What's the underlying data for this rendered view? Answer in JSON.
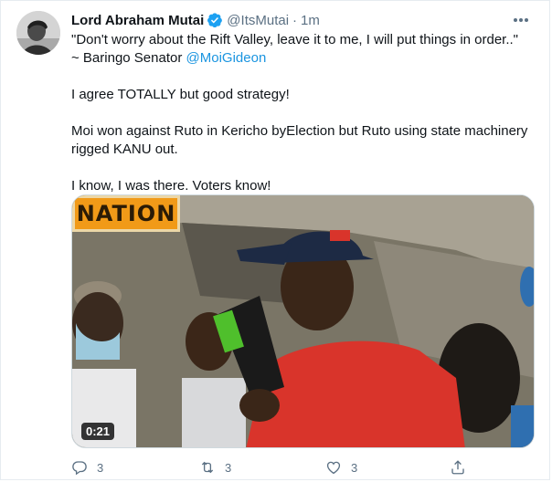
{
  "tweet": {
    "display_name": "Lord Abraham Mutai",
    "handle": "@ItsMutai",
    "separator": "·",
    "time": "1m",
    "quote_line": "\"Don't worry about the Rift Valley, leave it to me, I will put things in order..\"",
    "attribution_prefix": "~ Baringo Senator ",
    "attribution_mention": "@MoiGideon",
    "paragraph_2": "I agree TOTALLY but good strategy!",
    "paragraph_3": "Moi won against Ruto in Kericho byElection but Ruto using state machinery rigged KANU out.",
    "paragraph_4": "I know, I was there. Voters know!",
    "verified": true
  },
  "media": {
    "logo_text": "NATION",
    "duration": "0:21"
  },
  "actions": {
    "reply_count": "3",
    "retweet_count": "3",
    "like_count": "3"
  },
  "colors": {
    "link": "#1b95e0",
    "verified": "#1da1f2",
    "muted": "#5b7083"
  },
  "icons": [
    "avatar-photo",
    "verified-icon",
    "more-icon",
    "reply-icon",
    "retweet-icon",
    "like-icon",
    "share-icon"
  ]
}
